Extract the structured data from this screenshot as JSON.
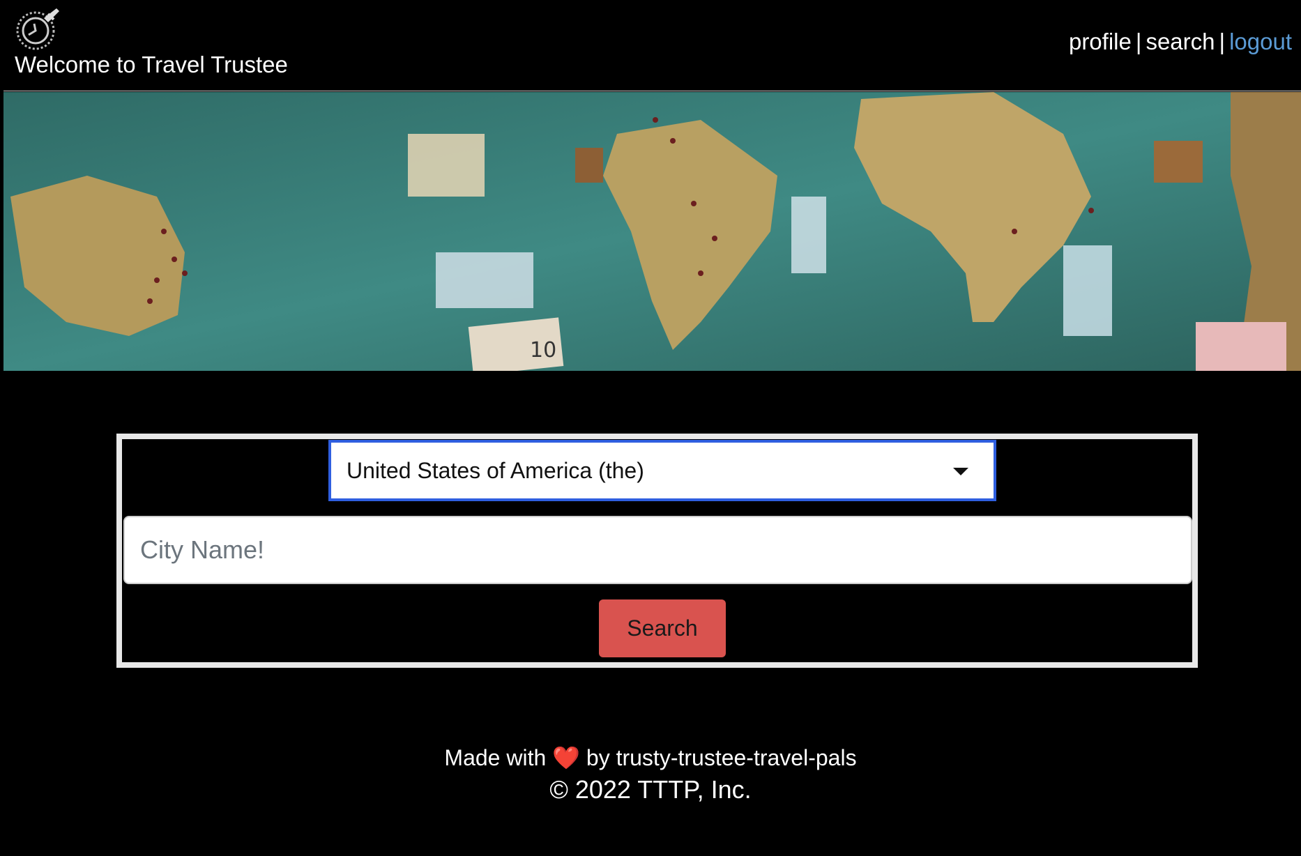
{
  "header": {
    "logo_icon": "compass-plane-icon",
    "title": "Welcome to Travel Trustee",
    "nav": {
      "profile": "profile",
      "separator": "|",
      "search": "search",
      "logout": "logout"
    }
  },
  "hero": {
    "image": "world-map-with-pins"
  },
  "search": {
    "country_selected": "United States of America (the)",
    "city_placeholder": "City Name!",
    "button_label": "Search"
  },
  "footer": {
    "made_with": "Made with",
    "heart": "❤️",
    "by_text": "by trusty-trustee-travel-pals",
    "copyright": "© 2022 TTTP, Inc."
  },
  "colors": {
    "background": "#000000",
    "link_accent": "#5b9bd5",
    "select_border": "#2f5fe0",
    "button": "#d9534f"
  }
}
